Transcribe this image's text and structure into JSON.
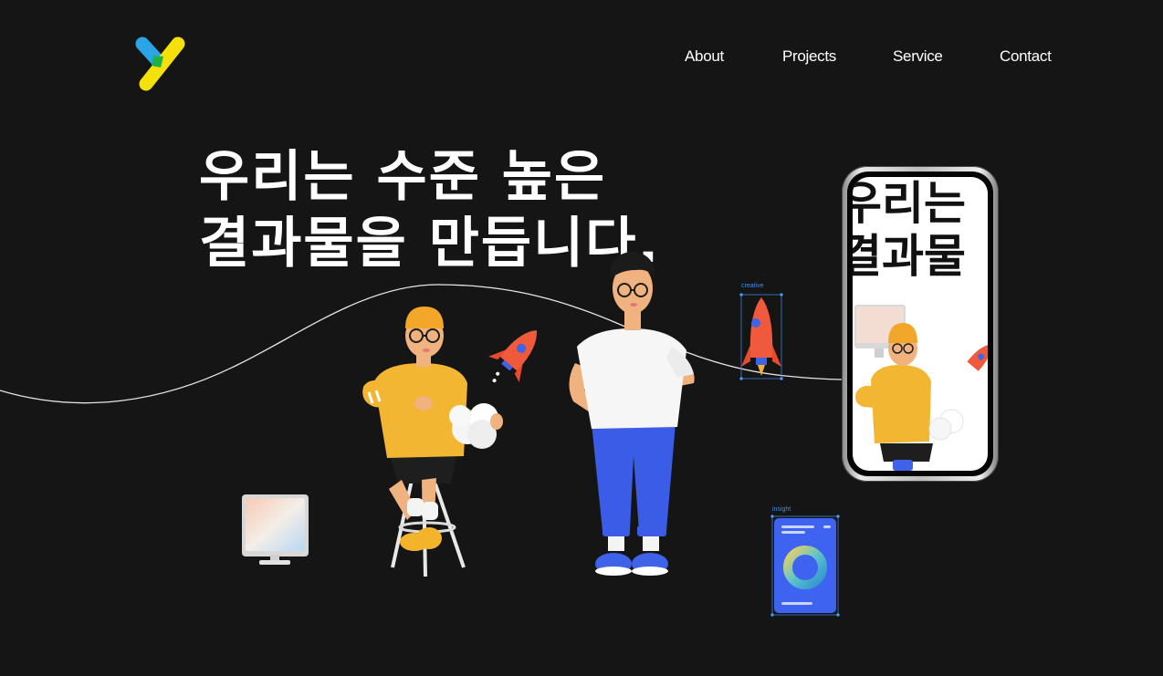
{
  "nav": {
    "items": [
      {
        "label": "About"
      },
      {
        "label": "Projects"
      },
      {
        "label": "Service"
      },
      {
        "label": "Contact"
      }
    ]
  },
  "hero": {
    "title_line1": "우리는 수준 높은",
    "title_line2": "결과물을 만듭니다."
  },
  "tags": {
    "creative": "creative",
    "insight": "insight"
  },
  "phone": {
    "line1": "우리는",
    "line2": "결과물"
  },
  "colors": {
    "background": "#151515",
    "logo_blue": "#2aa6e6",
    "logo_green": "#1fb04a",
    "logo_yellow": "#f4e10a",
    "character_yellow": "#f2b632",
    "pants_blue": "#3b5ce6",
    "rocket_red": "#ef5a3c",
    "card_blue": "#3d63f0"
  },
  "icons": [
    "logo-y-icon",
    "rocket-icon",
    "monitor-icon",
    "insight-card-icon"
  ]
}
